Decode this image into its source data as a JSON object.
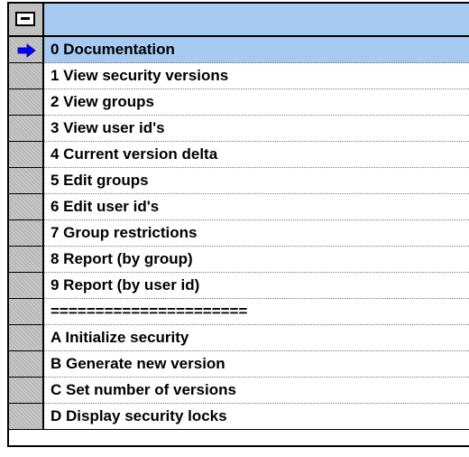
{
  "header": {
    "icon": "collapse-icon",
    "title": ""
  },
  "current_row_icon": "arrow-right-icon",
  "colors": {
    "header_bg": "#a6caf0",
    "current_row_bg": "#a6caf0",
    "arrow": "#0000ff"
  },
  "rows": [
    {
      "label": "0 Documentation"
    },
    {
      "label": "1 View security versions"
    },
    {
      "label": "2 View groups"
    },
    {
      "label": "3 View user id's"
    },
    {
      "label": "4 Current version delta"
    },
    {
      "label": "5 Edit groups"
    },
    {
      "label": "6 Edit user id's"
    },
    {
      "label": "7 Group restrictions"
    },
    {
      "label": "8 Report (by group)"
    },
    {
      "label": "9 Report (by user id)"
    },
    {
      "label": "======================"
    },
    {
      "label": "A Initialize security"
    },
    {
      "label": "B Generate new version"
    },
    {
      "label": "C Set number of versions"
    },
    {
      "label": "D Display security locks"
    }
  ]
}
